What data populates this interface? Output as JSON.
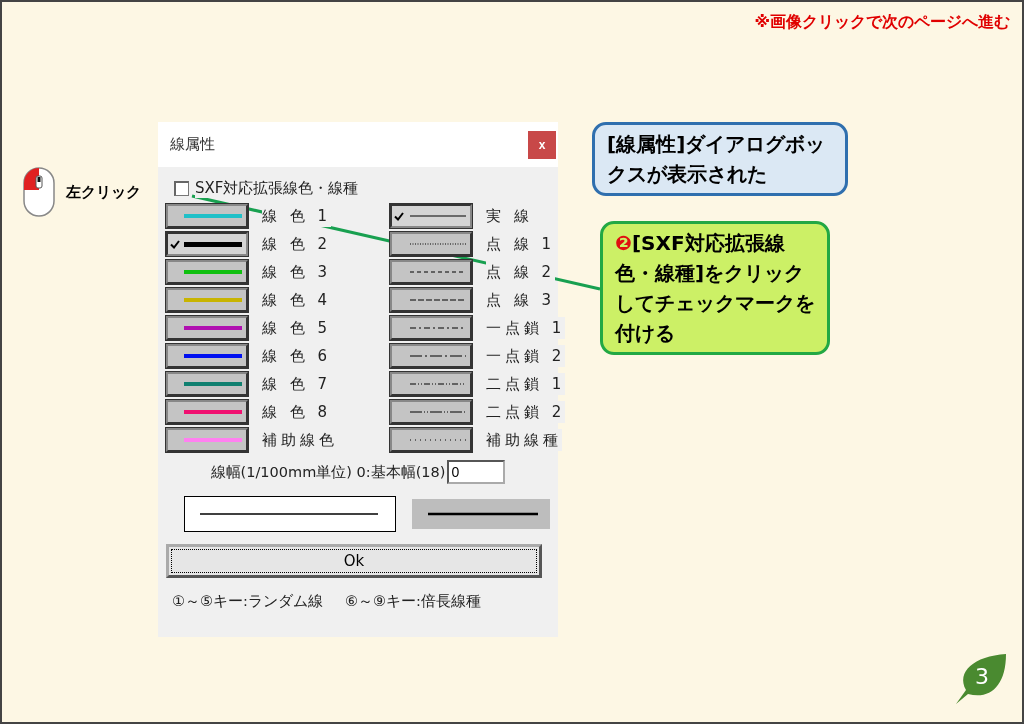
{
  "notice": "※画像クリックで次のページへ進む",
  "mouse_hint": {
    "label": "左クリック"
  },
  "dialog": {
    "title": "線属性",
    "close": "x",
    "sxf_checkbox": {
      "label": "SXF対応拡張線色・線種",
      "checked": false
    },
    "line_colors": [
      {
        "label": "線 色 1",
        "color": "#20c0c8",
        "selected": false
      },
      {
        "label": "線 色 2",
        "color": "#000000",
        "selected": true
      },
      {
        "label": "線 色 3",
        "color": "#10c010",
        "selected": false
      },
      {
        "label": "線 色 4",
        "color": "#c8b400",
        "selected": false
      },
      {
        "label": "線 色 5",
        "color": "#b010b0",
        "selected": false
      },
      {
        "label": "線 色 6",
        "color": "#0010f0",
        "selected": false
      },
      {
        "label": "線 色 7",
        "color": "#108070",
        "selected": false
      },
      {
        "label": "線 色 8",
        "color": "#f01070",
        "selected": false
      },
      {
        "label": "補助線色",
        "color": "#ff80f0",
        "selected": false
      }
    ],
    "line_types": [
      {
        "label": "実 線",
        "kind": "solid",
        "selected": true
      },
      {
        "label": "点 線 1",
        "kind": "dot1",
        "selected": false
      },
      {
        "label": "点 線 2",
        "kind": "dot2",
        "selected": false
      },
      {
        "label": "点 線 3",
        "kind": "dot3",
        "selected": false
      },
      {
        "label": "一点鎖 1",
        "kind": "chain1",
        "selected": false
      },
      {
        "label": "一点鎖 2",
        "kind": "chain2",
        "selected": false
      },
      {
        "label": "二点鎖 1",
        "kind": "dchain1",
        "selected": false
      },
      {
        "label": "二点鎖 2",
        "kind": "dchain2",
        "selected": false
      },
      {
        "label": "補助線種",
        "kind": "aux",
        "selected": false
      }
    ],
    "width_label": "線幅(1/100mm単位) 0:基本幅(18)",
    "width_value": "0",
    "ok_button": "Ok",
    "footer": [
      "①～⑤キー:ランダム線",
      "⑥～⑨キー:倍長線種"
    ]
  },
  "callouts": [
    {
      "kind": "info",
      "text": "[線属性]ダイアログボックスが表示された"
    },
    {
      "kind": "step",
      "badge": "❷",
      "text": "[SXF対応拡張線色・線種]をクリックしてチェックマークを付ける"
    }
  ],
  "page_number": "3"
}
